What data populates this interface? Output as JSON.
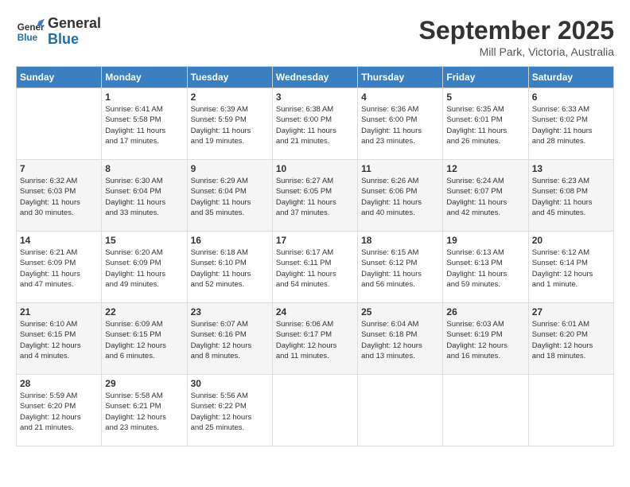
{
  "header": {
    "logo_line1": "General",
    "logo_line2": "Blue",
    "month": "September 2025",
    "location": "Mill Park, Victoria, Australia"
  },
  "days_of_week": [
    "Sunday",
    "Monday",
    "Tuesday",
    "Wednesday",
    "Thursday",
    "Friday",
    "Saturday"
  ],
  "weeks": [
    [
      {
        "day": "",
        "info": ""
      },
      {
        "day": "1",
        "info": "Sunrise: 6:41 AM\nSunset: 5:58 PM\nDaylight: 11 hours\nand 17 minutes."
      },
      {
        "day": "2",
        "info": "Sunrise: 6:39 AM\nSunset: 5:59 PM\nDaylight: 11 hours\nand 19 minutes."
      },
      {
        "day": "3",
        "info": "Sunrise: 6:38 AM\nSunset: 6:00 PM\nDaylight: 11 hours\nand 21 minutes."
      },
      {
        "day": "4",
        "info": "Sunrise: 6:36 AM\nSunset: 6:00 PM\nDaylight: 11 hours\nand 23 minutes."
      },
      {
        "day": "5",
        "info": "Sunrise: 6:35 AM\nSunset: 6:01 PM\nDaylight: 11 hours\nand 26 minutes."
      },
      {
        "day": "6",
        "info": "Sunrise: 6:33 AM\nSunset: 6:02 PM\nDaylight: 11 hours\nand 28 minutes."
      }
    ],
    [
      {
        "day": "7",
        "info": "Sunrise: 6:32 AM\nSunset: 6:03 PM\nDaylight: 11 hours\nand 30 minutes."
      },
      {
        "day": "8",
        "info": "Sunrise: 6:30 AM\nSunset: 6:04 PM\nDaylight: 11 hours\nand 33 minutes."
      },
      {
        "day": "9",
        "info": "Sunrise: 6:29 AM\nSunset: 6:04 PM\nDaylight: 11 hours\nand 35 minutes."
      },
      {
        "day": "10",
        "info": "Sunrise: 6:27 AM\nSunset: 6:05 PM\nDaylight: 11 hours\nand 37 minutes."
      },
      {
        "day": "11",
        "info": "Sunrise: 6:26 AM\nSunset: 6:06 PM\nDaylight: 11 hours\nand 40 minutes."
      },
      {
        "day": "12",
        "info": "Sunrise: 6:24 AM\nSunset: 6:07 PM\nDaylight: 11 hours\nand 42 minutes."
      },
      {
        "day": "13",
        "info": "Sunrise: 6:23 AM\nSunset: 6:08 PM\nDaylight: 11 hours\nand 45 minutes."
      }
    ],
    [
      {
        "day": "14",
        "info": "Sunrise: 6:21 AM\nSunset: 6:09 PM\nDaylight: 11 hours\nand 47 minutes."
      },
      {
        "day": "15",
        "info": "Sunrise: 6:20 AM\nSunset: 6:09 PM\nDaylight: 11 hours\nand 49 minutes."
      },
      {
        "day": "16",
        "info": "Sunrise: 6:18 AM\nSunset: 6:10 PM\nDaylight: 11 hours\nand 52 minutes."
      },
      {
        "day": "17",
        "info": "Sunrise: 6:17 AM\nSunset: 6:11 PM\nDaylight: 11 hours\nand 54 minutes."
      },
      {
        "day": "18",
        "info": "Sunrise: 6:15 AM\nSunset: 6:12 PM\nDaylight: 11 hours\nand 56 minutes."
      },
      {
        "day": "19",
        "info": "Sunrise: 6:13 AM\nSunset: 6:13 PM\nDaylight: 11 hours\nand 59 minutes."
      },
      {
        "day": "20",
        "info": "Sunrise: 6:12 AM\nSunset: 6:14 PM\nDaylight: 12 hours\nand 1 minute."
      }
    ],
    [
      {
        "day": "21",
        "info": "Sunrise: 6:10 AM\nSunset: 6:15 PM\nDaylight: 12 hours\nand 4 minutes."
      },
      {
        "day": "22",
        "info": "Sunrise: 6:09 AM\nSunset: 6:15 PM\nDaylight: 12 hours\nand 6 minutes."
      },
      {
        "day": "23",
        "info": "Sunrise: 6:07 AM\nSunset: 6:16 PM\nDaylight: 12 hours\nand 8 minutes."
      },
      {
        "day": "24",
        "info": "Sunrise: 6:06 AM\nSunset: 6:17 PM\nDaylight: 12 hours\nand 11 minutes."
      },
      {
        "day": "25",
        "info": "Sunrise: 6:04 AM\nSunset: 6:18 PM\nDaylight: 12 hours\nand 13 minutes."
      },
      {
        "day": "26",
        "info": "Sunrise: 6:03 AM\nSunset: 6:19 PM\nDaylight: 12 hours\nand 16 minutes."
      },
      {
        "day": "27",
        "info": "Sunrise: 6:01 AM\nSunset: 6:20 PM\nDaylight: 12 hours\nand 18 minutes."
      }
    ],
    [
      {
        "day": "28",
        "info": "Sunrise: 5:59 AM\nSunset: 6:20 PM\nDaylight: 12 hours\nand 21 minutes."
      },
      {
        "day": "29",
        "info": "Sunrise: 5:58 AM\nSunset: 6:21 PM\nDaylight: 12 hours\nand 23 minutes."
      },
      {
        "day": "30",
        "info": "Sunrise: 5:56 AM\nSunset: 6:22 PM\nDaylight: 12 hours\nand 25 minutes."
      },
      {
        "day": "",
        "info": ""
      },
      {
        "day": "",
        "info": ""
      },
      {
        "day": "",
        "info": ""
      },
      {
        "day": "",
        "info": ""
      }
    ]
  ]
}
